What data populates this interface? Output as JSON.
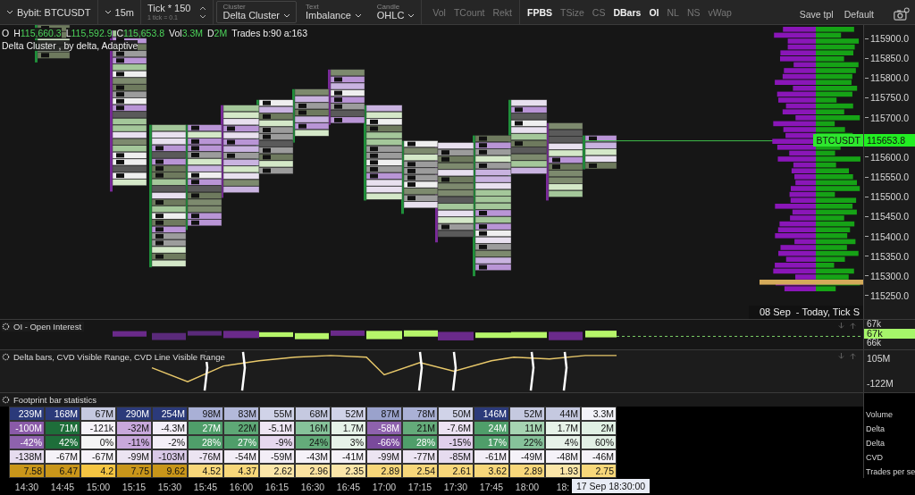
{
  "toolbar": {
    "symbol": "Bybit: BTCUSDT",
    "timeframe": "15m",
    "tick": {
      "value": "Tick * 150",
      "note": "1 tick = 0.1"
    },
    "dropdowns": [
      {
        "label": "Cluster",
        "value": "Delta Cluster",
        "boxed": true
      },
      {
        "label": "Text",
        "value": "Imbalance",
        "boxed": false
      },
      {
        "label": "Candle",
        "value": "OHLC",
        "boxed": false
      }
    ],
    "toggle_groups": [
      [
        {
          "label": "Vol",
          "on": false
        },
        {
          "label": "TCount",
          "on": false
        },
        {
          "label": "Rekt",
          "on": false
        }
      ],
      [
        {
          "label": "FPBS",
          "on": true
        },
        {
          "label": "TSize",
          "on": false
        },
        {
          "label": "CS",
          "on": false
        },
        {
          "label": "DBars",
          "on": true
        },
        {
          "label": "OI",
          "on": true
        },
        {
          "label": "NL",
          "on": false
        },
        {
          "label": "NS",
          "on": false
        },
        {
          "label": "vWap",
          "on": false
        }
      ]
    ],
    "actions": [
      "Save tpl",
      "Default"
    ]
  },
  "chart": {
    "ohlc": [
      {
        "label": "O"
      },
      {
        "label": "H",
        "value": "115,660.3"
      },
      {
        "label": "L",
        "value": "115,592.9"
      },
      {
        "label": "C",
        "value": "115,653.8"
      },
      {
        "label": "Vol",
        "value": "3.3M"
      },
      {
        "label": "D",
        "value": "2M"
      },
      {
        "label": "Trades b:90 a:163"
      }
    ],
    "indicator_label": "Delta Cluster , by delta, Adaptive",
    "price_axis": [
      "115900.0",
      "115850.0",
      "115800.0",
      "115750.0",
      "115700.0",
      "115600.0",
      "115550.0",
      "115500.0",
      "115450.0",
      "115400.0",
      "115350.0",
      "115300.0",
      "115250.0"
    ],
    "symbol_tag": "BTCUSDT",
    "last_price": "115653.8",
    "range_label": "08 Sep  - Today, Tick S"
  },
  "oi_pane": {
    "title": "OI - Open Interest",
    "axis": [
      "67k",
      "66k"
    ],
    "badge": "67k"
  },
  "delta_pane": {
    "title": "Delta bars, CVD Visible Range, CVD Line Visible Range",
    "axis": [
      "105M",
      "-122M"
    ]
  },
  "stats": {
    "title": "Footprint bar statistics",
    "rows": [
      {
        "label": "Volume",
        "cells": [
          {
            "text": "239M",
            "color": "#2b3a7a"
          },
          {
            "text": "168M",
            "color": "#2b3a7a"
          },
          {
            "text": "67M",
            "color": "#c5c9e0"
          },
          {
            "text": "290M",
            "color": "#2b3a7a"
          },
          {
            "text": "254M",
            "color": "#2b3a7a"
          },
          {
            "text": "98M",
            "color": "#a9b0d6"
          },
          {
            "text": "83M",
            "color": "#b3b9da"
          },
          {
            "text": "55M",
            "color": "#d0d3e8"
          },
          {
            "text": "68M",
            "color": "#c5c9e0"
          },
          {
            "text": "52M",
            "color": "#d0d3e8"
          },
          {
            "text": "87M",
            "color": "#9aa2cc"
          },
          {
            "text": "78M",
            "color": "#aab1d6"
          },
          {
            "text": "50M",
            "color": "#d0d3e8"
          },
          {
            "text": "146M",
            "color": "#2b3a7a"
          },
          {
            "text": "52M",
            "color": "#c5c9e0"
          },
          {
            "text": "44M",
            "color": "#c5c9e0"
          },
          {
            "text": "3.3M",
            "color": "#f2f2f8"
          }
        ]
      },
      {
        "label": "Delta",
        "cells": [
          {
            "text": "-100M",
            "color": "#8a5aa8"
          },
          {
            "text": "71M",
            "color": "#1e6e3a"
          },
          {
            "text": "-121k",
            "color": "#f5f2f8"
          },
          {
            "text": "-32M",
            "color": "#c8a8dc"
          },
          {
            "text": "-4.3M",
            "color": "#f3eef7"
          },
          {
            "text": "27M",
            "color": "#4f9e6a"
          },
          {
            "text": "22M",
            "color": "#5ea876"
          },
          {
            "text": "-5.1M",
            "color": "#eee6f3"
          },
          {
            "text": "16M",
            "color": "#86c29a"
          },
          {
            "text": "1.7M",
            "color": "#e6f2e8"
          },
          {
            "text": "-58M",
            "color": "#8e62ad"
          },
          {
            "text": "21M",
            "color": "#64ab7a"
          },
          {
            "text": "-7.6M",
            "color": "#ece2f2"
          },
          {
            "text": "24M",
            "color": "#4f9e6a"
          },
          {
            "text": "11M",
            "color": "#a6d4b2"
          },
          {
            "text": "1.7M",
            "color": "#e6f2e8"
          },
          {
            "text": "2M",
            "color": "#e0f0e4"
          }
        ]
      },
      {
        "label": "Delta",
        "cells": [
          {
            "text": "-42%",
            "color": "#8e62ad"
          },
          {
            "text": "42%",
            "color": "#1e6e3a"
          },
          {
            "text": "0%",
            "color": "#f5f5f5"
          },
          {
            "text": "-11%",
            "color": "#c8a8dc"
          },
          {
            "text": "-2%",
            "color": "#f3eef7"
          },
          {
            "text": "28%",
            "color": "#4f9e6a"
          },
          {
            "text": "27%",
            "color": "#4f9e6a"
          },
          {
            "text": "-9%",
            "color": "#e6d8ef"
          },
          {
            "text": "24%",
            "color": "#64ab7a"
          },
          {
            "text": "3%",
            "color": "#e6f2e8"
          },
          {
            "text": "-66%",
            "color": "#7a4a9c"
          },
          {
            "text": "28%",
            "color": "#4f9e6a"
          },
          {
            "text": "-15%",
            "color": "#e0cfeb"
          },
          {
            "text": "17%",
            "color": "#4f9e6a"
          },
          {
            "text": "22%",
            "color": "#86c29a"
          },
          {
            "text": "4%",
            "color": "#e6f2e8"
          },
          {
            "text": "60%",
            "color": "#e2f0e5"
          }
        ]
      },
      {
        "label": "CVD",
        "cells": [
          {
            "text": "-138M",
            "color": "#e6dcef"
          },
          {
            "text": "-67M",
            "color": "#f5f2f8"
          },
          {
            "text": "-67M",
            "color": "#f5f2f8"
          },
          {
            "text": "-99M",
            "color": "#ece4f2"
          },
          {
            "text": "-103M",
            "color": "#d8c8e6"
          },
          {
            "text": "-76M",
            "color": "#ece4f2"
          },
          {
            "text": "-54M",
            "color": "#f3eef7"
          },
          {
            "text": "-59M",
            "color": "#f3eef7"
          },
          {
            "text": "-43M",
            "color": "#f5f2f8"
          },
          {
            "text": "-41M",
            "color": "#f5f2f8"
          },
          {
            "text": "-99M",
            "color": "#ece4f2"
          },
          {
            "text": "-77M",
            "color": "#ece4f2"
          },
          {
            "text": "-85M",
            "color": "#e6dcef"
          },
          {
            "text": "-61M",
            "color": "#f3eef7"
          },
          {
            "text": "-49M",
            "color": "#f5f2f8"
          },
          {
            "text": "-48M",
            "color": "#f5f2f8"
          },
          {
            "text": "-46M",
            "color": "#f5f2f8"
          }
        ]
      },
      {
        "label": "Trades per se",
        "cells": [
          {
            "text": "7.58",
            "color": "#c9961a"
          },
          {
            "text": "6.47",
            "color": "#c9961a"
          },
          {
            "text": "4.2",
            "color": "#f5c542"
          },
          {
            "text": "7.75",
            "color": "#c9961a"
          },
          {
            "text": "9.62",
            "color": "#c9961a"
          },
          {
            "text": "4.52",
            "color": "#f7d77a"
          },
          {
            "text": "4.37",
            "color": "#f7d77a"
          },
          {
            "text": "2.62",
            "color": "#fbe6a8"
          },
          {
            "text": "2.96",
            "color": "#fbe2a0"
          },
          {
            "text": "2.35",
            "color": "#fbe6a8"
          },
          {
            "text": "2.89",
            "color": "#f7d77a"
          },
          {
            "text": "2.54",
            "color": "#f7d77a"
          },
          {
            "text": "2.61",
            "color": "#f7d77a"
          },
          {
            "text": "3.62",
            "color": "#f7d77a"
          },
          {
            "text": "2.89",
            "color": "#f7d77a"
          },
          {
            "text": "1.93",
            "color": "#fbe6a8"
          },
          {
            "text": "2.75",
            "color": "#f7d77a"
          }
        ]
      }
    ]
  },
  "time_axis": {
    "labels": [
      "14:30",
      "14:45",
      "15:00",
      "15:15",
      "15:30",
      "15:45",
      "16:00",
      "16:15",
      "16:30",
      "16:45",
      "17:00",
      "17:15",
      "17:30",
      "17:45",
      "18:00",
      "18:"
    ],
    "cursor_label": "17 Sep 18:30:00"
  }
}
